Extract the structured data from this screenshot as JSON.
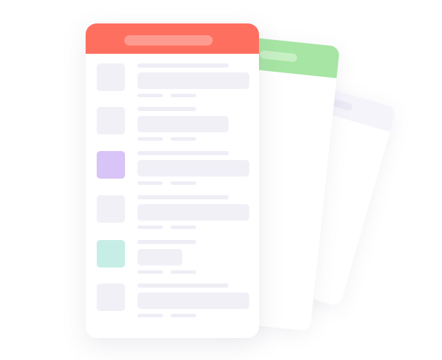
{
  "illustration": {
    "cards": [
      {
        "id": "front",
        "header_color": "#fe6f60"
      },
      {
        "id": "middle",
        "header_color": "#a6e5a3"
      },
      {
        "id": "back",
        "header_color": "#f6f4fb"
      }
    ],
    "rows": [
      {
        "thumb_color": "#f2f0f7",
        "wide": true
      },
      {
        "thumb_color": "#f2f0f7",
        "wide": false
      },
      {
        "thumb_color": "#d8c4f6",
        "wide": true
      },
      {
        "thumb_color": "#f2f0f7",
        "wide": true
      },
      {
        "thumb_color": "#c7eee6",
        "wide": false
      },
      {
        "thumb_color": "#f2f0f7",
        "wide": true
      }
    ],
    "placeholder_color": "#f2f0f7"
  }
}
